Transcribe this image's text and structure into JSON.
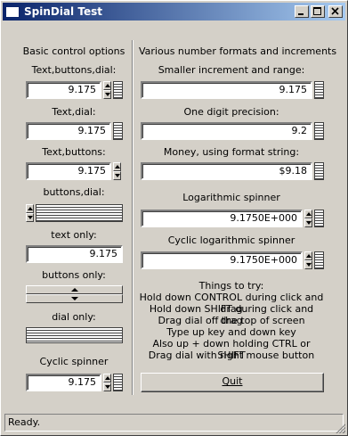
{
  "window": {
    "title": "SpinDial Test"
  },
  "left": {
    "header": "Basic control options",
    "sections": [
      {
        "label": "Text,buttons,dial:",
        "value": "9.175"
      },
      {
        "label": "Text,dial:",
        "value": "9.175"
      },
      {
        "label": "Text,buttons:",
        "value": "9.175"
      },
      {
        "label": "buttons,dial:"
      },
      {
        "label": "text only:",
        "value": "9.175"
      },
      {
        "label": "buttons only:"
      },
      {
        "label": "dial only:"
      },
      {
        "label": "Cyclic spinner",
        "value": "9.175"
      }
    ]
  },
  "right": {
    "header": "Various number formats and increments",
    "sections": [
      {
        "label": "Smaller increment and range:",
        "value": "9.175"
      },
      {
        "label": "One digit precision:",
        "value": "9.2"
      },
      {
        "label": "Money, using format string:",
        "value": "$9.18"
      },
      {
        "label": "Logarithmic spinner",
        "value": "9.1750E+000"
      },
      {
        "label": "Cyclic logarithmic spinner",
        "value": "9.1750E+000"
      }
    ],
    "hints": [
      "Things to try:",
      "Hold down CONTROL during click and drag",
      "Hold down SHIFT during click and drag",
      "Drag dial off the top of screen",
      "Type up key and down key",
      "Also up + down holding CTRL or SHIFT",
      "Drag dial with right mouse button"
    ],
    "quit_label": "Quit"
  },
  "status": "Ready."
}
